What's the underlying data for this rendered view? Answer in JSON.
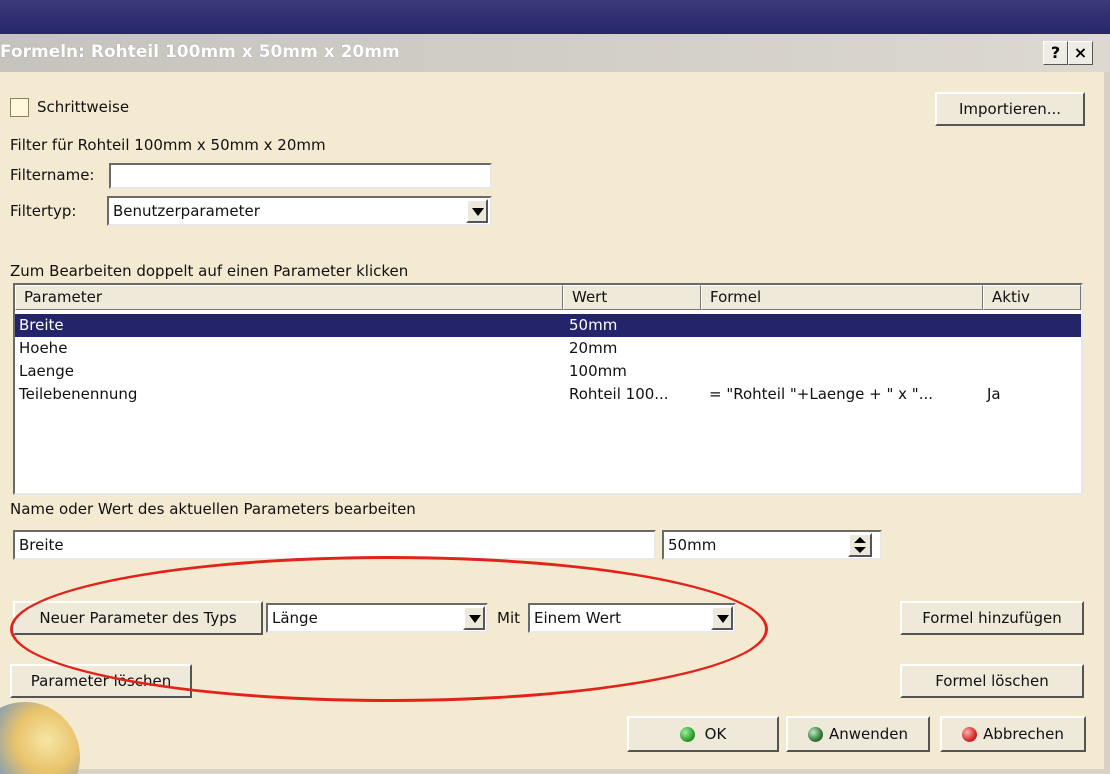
{
  "window": {
    "title": "Formeln: Rohteil 100mm x 50mm x 20mm",
    "help_label": "?",
    "close_label": "×"
  },
  "options": {
    "stepwise_label": "Schrittweise",
    "stepwise_checked": false,
    "import_label": "Importieren..."
  },
  "filter": {
    "caption": "Filter für Rohteil 100mm x 50mm x 20mm",
    "name_label": "Filtername:",
    "name_value": "",
    "type_label": "Filtertyp:",
    "type_value": "Benutzerparameter"
  },
  "table": {
    "hint": "Zum Bearbeiten doppelt auf einen Parameter klicken",
    "columns": [
      "Parameter",
      "Wert",
      "Formel",
      "Aktiv"
    ],
    "rows": [
      {
        "parameter": "Breite",
        "value": "50mm",
        "formula": "",
        "active": "",
        "selected": true
      },
      {
        "parameter": "Hoehe",
        "value": "20mm",
        "formula": "",
        "active": "",
        "selected": false
      },
      {
        "parameter": "Laenge",
        "value": "100mm",
        "formula": "",
        "active": "",
        "selected": false
      },
      {
        "parameter": "Teilebenennung",
        "value": "Rohteil 100...",
        "formula": "= \"Rohteil \"+Laenge + \" x \"...",
        "active": "Ja",
        "selected": false
      }
    ]
  },
  "edit": {
    "caption": "Name oder Wert des aktuellen Parameters bearbeiten",
    "name_value": "Breite",
    "value_value": "50mm"
  },
  "new_param": {
    "button_label": "Neuer Parameter des Typs",
    "type_value": "Länge",
    "with_label": "Mit",
    "with_value": "Einem Wert",
    "add_formula_label": "Formel hinzufügen",
    "delete_param_label": "Parameter löschen",
    "delete_formula_label": "Formel löschen"
  },
  "footer": {
    "ok_label": "OK",
    "apply_label": "Anwenden",
    "cancel_label": "Abbrechen"
  },
  "colors": {
    "ok_dot": "#2e9e2e",
    "apply_dot": "#2f7a3a",
    "cancel_dot": "#d62a2a",
    "annotation_ellipse": "#e2231a",
    "selection": "#23246a"
  }
}
